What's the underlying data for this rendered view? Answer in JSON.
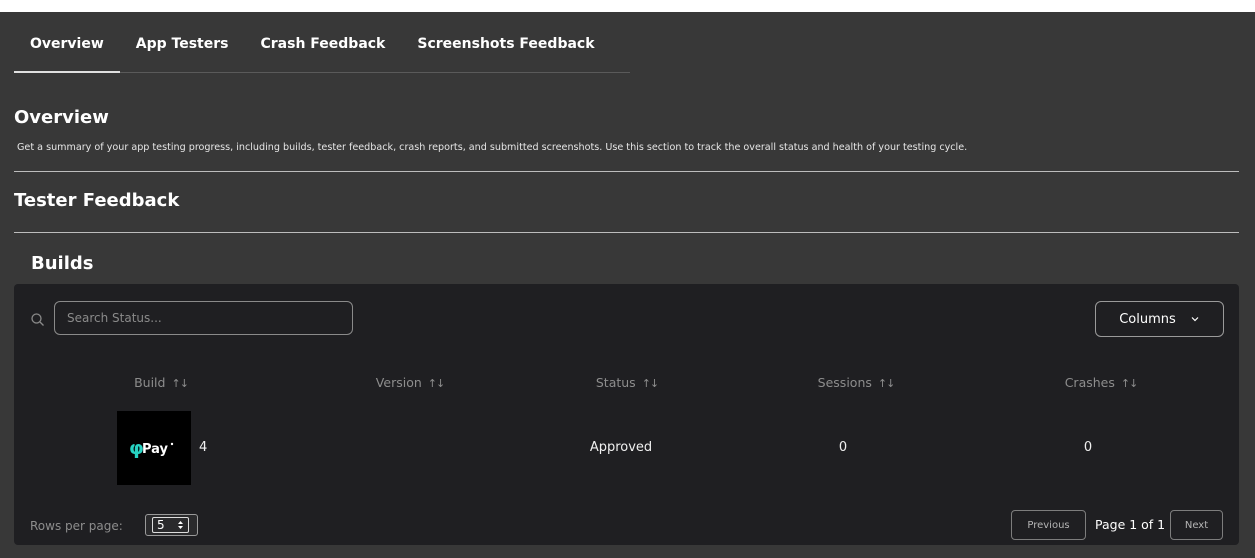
{
  "tabs": [
    {
      "label": "Overview",
      "active": true
    },
    {
      "label": "App Testers",
      "active": false
    },
    {
      "label": "Crash Feedback",
      "active": false
    },
    {
      "label": "Screenshots Feedback",
      "active": false
    }
  ],
  "overview": {
    "title": "Overview",
    "description": "Get a summary of your app testing progress, including builds, tester feedback, crash reports, and submitted screenshots. Use this section to track the overall status and health of your testing cycle."
  },
  "tester_feedback": {
    "title": "Tester Feedback"
  },
  "builds": {
    "title": "Builds",
    "search": {
      "placeholder": "Search Status...",
      "icon": "search-icon"
    },
    "columns_button": {
      "label": "Columns",
      "icon": "chevron-down-icon"
    },
    "columns": [
      {
        "label": "Build",
        "sort_icon": "↑↓"
      },
      {
        "label": "Version",
        "sort_icon": "↑↓"
      },
      {
        "label": "Status",
        "sort_icon": "↑↓"
      },
      {
        "label": "Sessions",
        "sort_icon": "↑↓"
      },
      {
        "label": "Crashes",
        "sort_icon": "↑↓"
      }
    ],
    "rows": [
      {
        "logo_text": "Pay",
        "build": "4",
        "version": "",
        "status": "Approved",
        "sessions": "0",
        "crashes": "0"
      }
    ],
    "pagination": {
      "rows_per_page_label": "Rows per page:",
      "rows_per_page_value": "5",
      "previous_label": "Previous",
      "page_label": "Page 1 of 1",
      "next_label": "Next"
    }
  },
  "colors": {
    "panel_bg": "#383838",
    "card_bg": "#1f1f22",
    "logo_accent": "#27d3c2"
  }
}
